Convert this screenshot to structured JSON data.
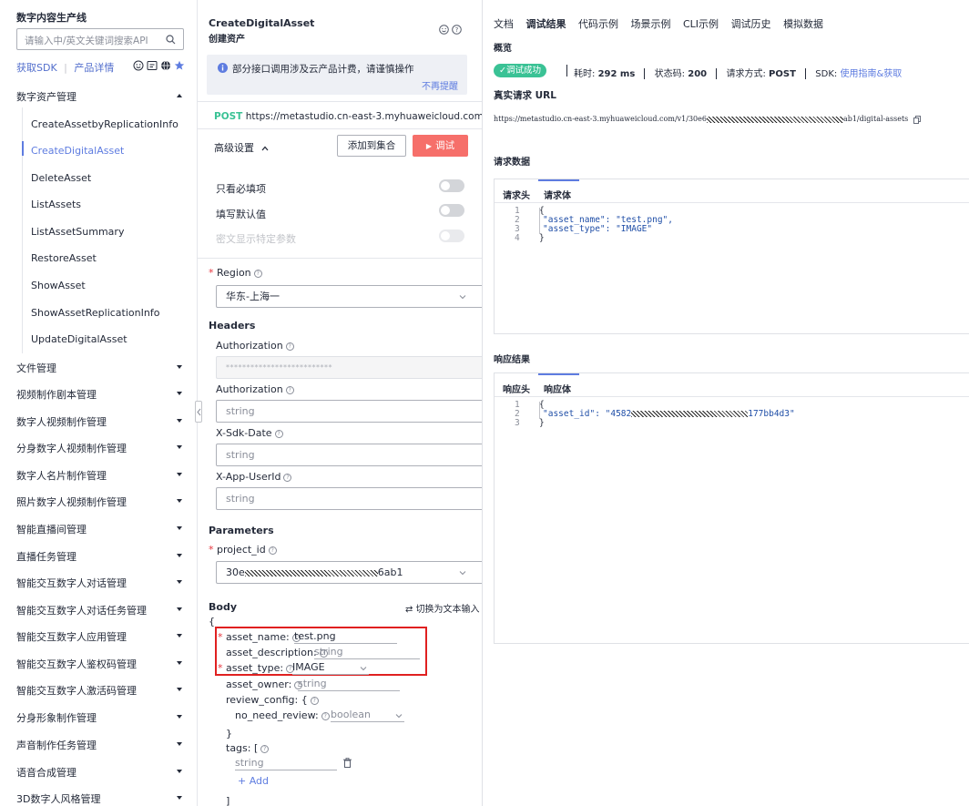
{
  "sidebar": {
    "title": "数字内容生产线",
    "search_placeholder": "请输入中/英文关键词搜索API",
    "link_sdk": "获取SDK",
    "link_sep": "|",
    "link_detail": "产品详情",
    "group_open": "数字资产管理",
    "sub_items": [
      "CreateAssetbyReplicationInfo",
      "CreateDigitalAsset",
      "DeleteAsset",
      "ListAssets",
      "ListAssetSummary",
      "RestoreAsset",
      "ShowAsset",
      "ShowAssetReplicationInfo",
      "UpdateDigitalAsset"
    ],
    "groups": [
      "文件管理",
      "视频制作剧本管理",
      "数字人视频制作管理",
      "分身数字人视频制作管理",
      "数字人名片制作管理",
      "照片数字人视频制作管理",
      "智能直播间管理",
      "直播任务管理",
      "智能交互数字人对话管理",
      "智能交互数字人对话任务管理",
      "智能交互数字人应用管理",
      "智能交互数字人鉴权码管理",
      "智能交互数字人激活码管理",
      "分身形象制作管理",
      "声音制作任务管理",
      "语音合成管理",
      "3D数字人风格管理"
    ]
  },
  "middle": {
    "api_name": "CreateDigitalAsset",
    "api_desc": "创建资产",
    "notice": "部分接口调用涉及云产品计费，请谨慎操作",
    "notice_dismiss": "不再提醒",
    "method": "POST",
    "url": "https://metastudio.cn-east-3.myhuaweicloud.com/...",
    "advanced": "高级设置",
    "add_to_set": "添加到集合",
    "debug": "调试",
    "toggles": [
      "只看必填项",
      "填写默认值",
      "密文显示特定参数"
    ],
    "region_label": "Region",
    "region_value": "华东-上海一",
    "headers_title": "Headers",
    "auth_label": "Authorization",
    "auth_masked": "**************************",
    "auth2_label": "Authorization",
    "string_placeholder": "string",
    "sdk_date_label": "X-Sdk-Date",
    "app_user_label": "X-App-UserId",
    "params_title": "Parameters",
    "project_id_label": "project_id",
    "project_id_prefix": "30e",
    "project_id_suffix": "6ab1",
    "body_title": "Body",
    "switch_text": "切换为文本输入",
    "brace_open": "{",
    "asset_name_key": "asset_name:",
    "asset_name_val": "test.png",
    "asset_desc_key": "asset_description:",
    "asset_desc_val": "string",
    "asset_type_key": "asset_type:",
    "asset_type_val": "IMAGE",
    "asset_owner_key": "asset_owner:",
    "asset_owner_val": "string",
    "review_key": "review_config: {",
    "no_need_key": "no_need_review:",
    "no_need_val": "boolean",
    "brace_close": "}",
    "tags_key": "tags: [",
    "tags_val": "string",
    "add": "+ Add",
    "bracket_close": "]"
  },
  "right": {
    "tabs": [
      "文档",
      "调试结果",
      "代码示例",
      "场景示例",
      "CLI示例",
      "调试历史",
      "模拟数据"
    ],
    "overview": "概览",
    "success": "✓调试成功",
    "time_label": "耗时:",
    "time_value": "292 ms",
    "status_label": "状态码:",
    "status_value": "200",
    "method_label": "请求方式:",
    "method_value": "POST",
    "sdk_label": "SDK:",
    "sdk_link": "使用指南&获取",
    "url_title": "真实请求 URL",
    "url_prefix": "https://metastudio.cn-east-3.myhuaweicloud.com/v1/30e6",
    "url_suffix": "ab1/digital-assets",
    "req_title": "请求数据",
    "req_tabs": [
      "请求头",
      "请求体"
    ],
    "req_lines": [
      "{",
      "\"asset_name\": \"test.png\",",
      "\"asset_type\": \"IMAGE\"",
      "}"
    ],
    "resp_title": "响应结果",
    "resp_tabs": [
      "响应头",
      "响应体"
    ],
    "resp_line1": "{",
    "resp_key": "\"asset_id\": \"4582",
    "resp_suffix": "177bb4d3\"",
    "resp_line3": "}",
    "line_nums": [
      "1",
      "2",
      "3",
      "4"
    ]
  },
  "colors": {
    "accent": "#5e7ce0",
    "success": "#3ac295",
    "danger": "#f66f6a",
    "highlight_box": "#e02020"
  }
}
